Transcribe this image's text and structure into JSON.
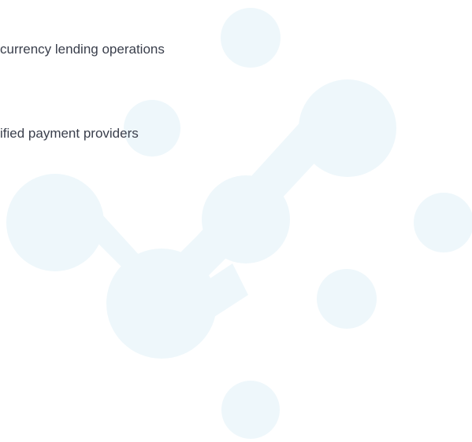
{
  "feature_list": {
    "items": [
      {
        "text": "currency lending operations"
      },
      {
        "text": "ified payment providers"
      }
    ]
  },
  "colors": {
    "background": "#ffffff",
    "text": "#3a3f4c",
    "decoration": "#eef7fb"
  },
  "decoration": {
    "icon": "connected-circles-network"
  }
}
